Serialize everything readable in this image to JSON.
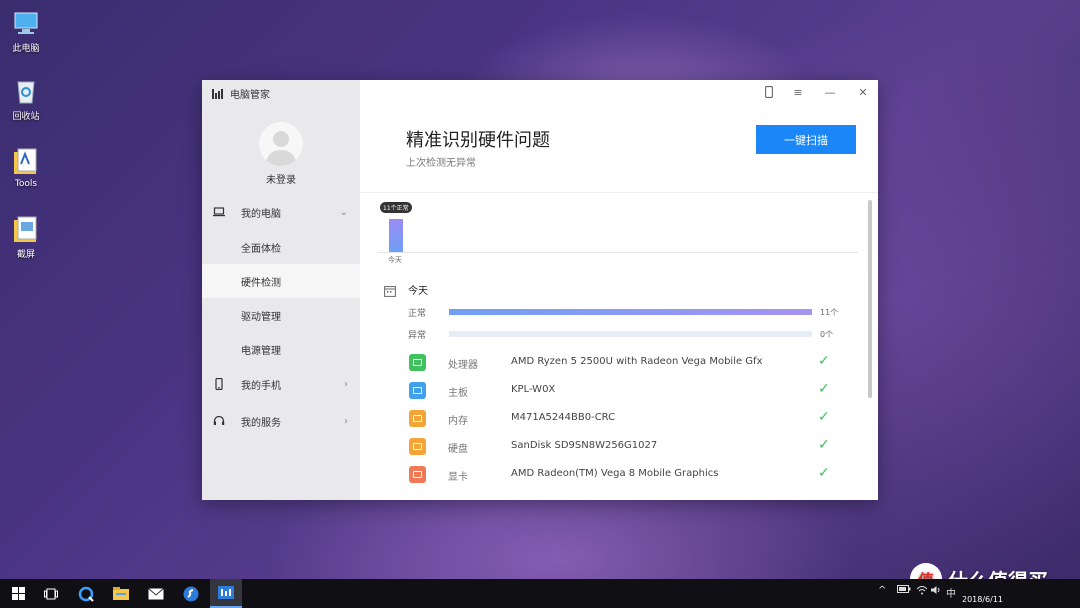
{
  "desktop": {
    "icons": [
      {
        "label": "此电脑",
        "icon": "computer-icon"
      },
      {
        "label": "回收站",
        "icon": "recycle-bin-icon"
      },
      {
        "label": "Tools",
        "icon": "folder-icon"
      },
      {
        "label": "截屏",
        "icon": "folder-icon"
      }
    ]
  },
  "window": {
    "app_title": "电脑管家",
    "controls": {
      "phone": "phone-icon",
      "menu": "≡",
      "minimize": "—",
      "close": "✕"
    },
    "sidebar": {
      "login_label": "未登录",
      "my_pc": {
        "label": "我的电脑",
        "icon": "laptop-icon"
      },
      "sub_items": [
        {
          "label": "全面体检"
        },
        {
          "label": "硬件检测"
        },
        {
          "label": "驱动管理"
        },
        {
          "label": "电源管理"
        }
      ],
      "my_phone": {
        "label": "我的手机",
        "icon": "phone-icon"
      },
      "my_service": {
        "label": "我的服务",
        "icon": "headset-icon"
      }
    },
    "main": {
      "headline": "精准识别硬件问题",
      "subline": "上次检测无异常",
      "scan_button": "一键扫描",
      "history": {
        "tooltip": "11个正常",
        "date": "今天",
        "normal_count": 11
      },
      "today_label": "今天",
      "stats": [
        {
          "label": "正常",
          "count": "11个",
          "fraction": 1.0
        },
        {
          "label": "异常",
          "count": "0个",
          "fraction": 0.0
        }
      ],
      "hardware": [
        {
          "category": "处理器",
          "value": "AMD Ryzen 5 2500U with Radeon Vega Mobile Gfx",
          "color": "#3fc25d",
          "status": "ok"
        },
        {
          "category": "主板",
          "value": "KPL-W0X",
          "color": "#3fa0f0",
          "status": "ok"
        },
        {
          "category": "内存",
          "value": "M471A5244BB0-CRC",
          "color": "#f5a537",
          "status": "ok"
        },
        {
          "category": "硬盘",
          "value": "SanDisk SD9SN8W256G1027",
          "color": "#f5a537",
          "status": "ok"
        },
        {
          "category": "显卡",
          "value": "AMD Radeon(TM) Vega 8 Mobile Graphics",
          "color": "#f07a56",
          "status": "ok"
        }
      ]
    }
  },
  "taskbar": {
    "items": [
      "windows-start-icon",
      "task-view-icon",
      "search-q-icon",
      "file-explorer-icon",
      "mail-icon",
      "browser-icon",
      "pc-manager-icon"
    ],
    "tray": {
      "chevron": "^",
      "ime": "中",
      "date": "2018/6/11"
    }
  },
  "watermark": {
    "glyph": "值",
    "text": "什么值得买"
  }
}
